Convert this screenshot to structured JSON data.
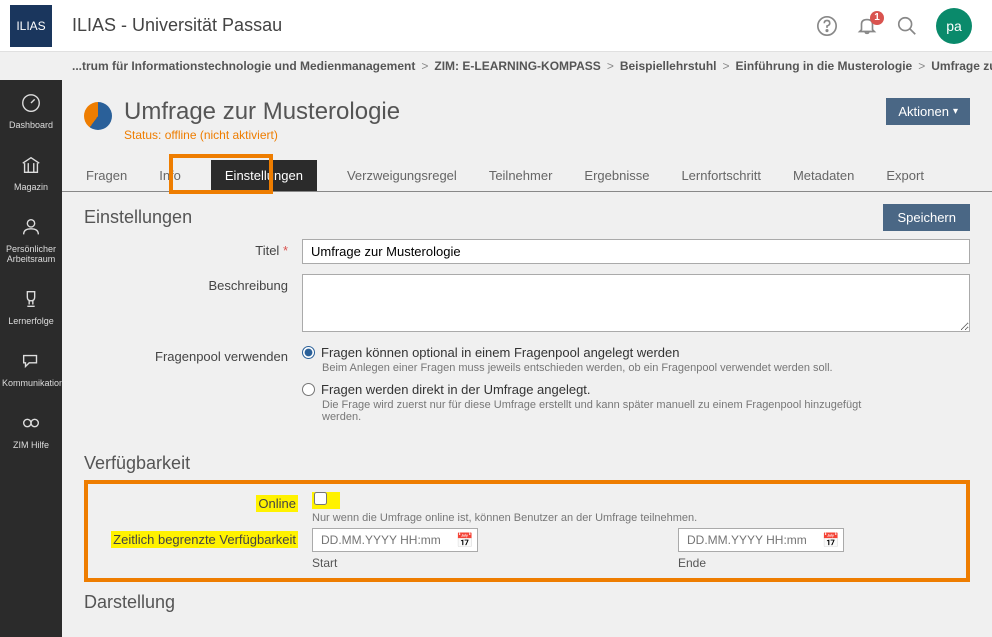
{
  "header": {
    "logo_text": "ILIAS",
    "title": "ILIAS - Universität Passau",
    "notification_count": "1",
    "avatar_initials": "pa"
  },
  "breadcrumb": {
    "items": [
      "...trum für Informationstechnologie und Medienmanagement",
      "ZIM: E-LEARNING-KOMPASS",
      "Beispiellehrstuhl",
      "Einführung in die Musterologie",
      "Umfrage zur Musterolog"
    ],
    "separator": ">"
  },
  "sidebar": {
    "items": [
      {
        "label": "Dashboard"
      },
      {
        "label": "Magazin"
      },
      {
        "label": "Persönlicher Arbeitsraum"
      },
      {
        "label": "Lernerfolge"
      },
      {
        "label": "Kommunikation"
      },
      {
        "label": "ZIM Hilfe"
      }
    ]
  },
  "page": {
    "title": "Umfrage zur Musterologie",
    "status": "Status: offline (nicht aktiviert)",
    "actions_label": "Aktionen"
  },
  "tabs": {
    "items": [
      "Fragen",
      "Info",
      "Einstellungen",
      "Verzweigungsregel",
      "Teilnehmer",
      "Ergebnisse",
      "Lernfortschritt",
      "Metadaten",
      "Export"
    ],
    "active_index": 2
  },
  "form": {
    "section1_title": "Einstellungen",
    "save_label": "Speichern",
    "title_label": "Titel",
    "title_value": "Umfrage zur Musterologie",
    "description_label": "Beschreibung",
    "pool_label": "Fragenpool verwenden",
    "pool_opt1": "Fragen können optional in einem Fragenpool angelegt werden",
    "pool_opt1_help": "Beim Anlegen einer Fragen muss jeweils entschieden werden, ob ein Fragenpool verwendet werden soll.",
    "pool_opt2": "Fragen werden direkt in der Umfrage angelegt.",
    "pool_opt2_help": "Die Frage wird zuerst nur für diese Umfrage erstellt und kann später manuell zu einem Fragenpool hinzugefügt werden.",
    "section2_title": "Verfügbarkeit",
    "online_label": "Online",
    "online_help": "Nur wenn die Umfrage online ist, können Benutzer an der Umfrage teilnehmen.",
    "limited_label": "Zeitlich begrenzte Verfügbarkeit",
    "date_placeholder": "DD.MM.YYYY HH:mm",
    "start_label": "Start",
    "end_label": "Ende",
    "section3_title": "Darstellung"
  }
}
